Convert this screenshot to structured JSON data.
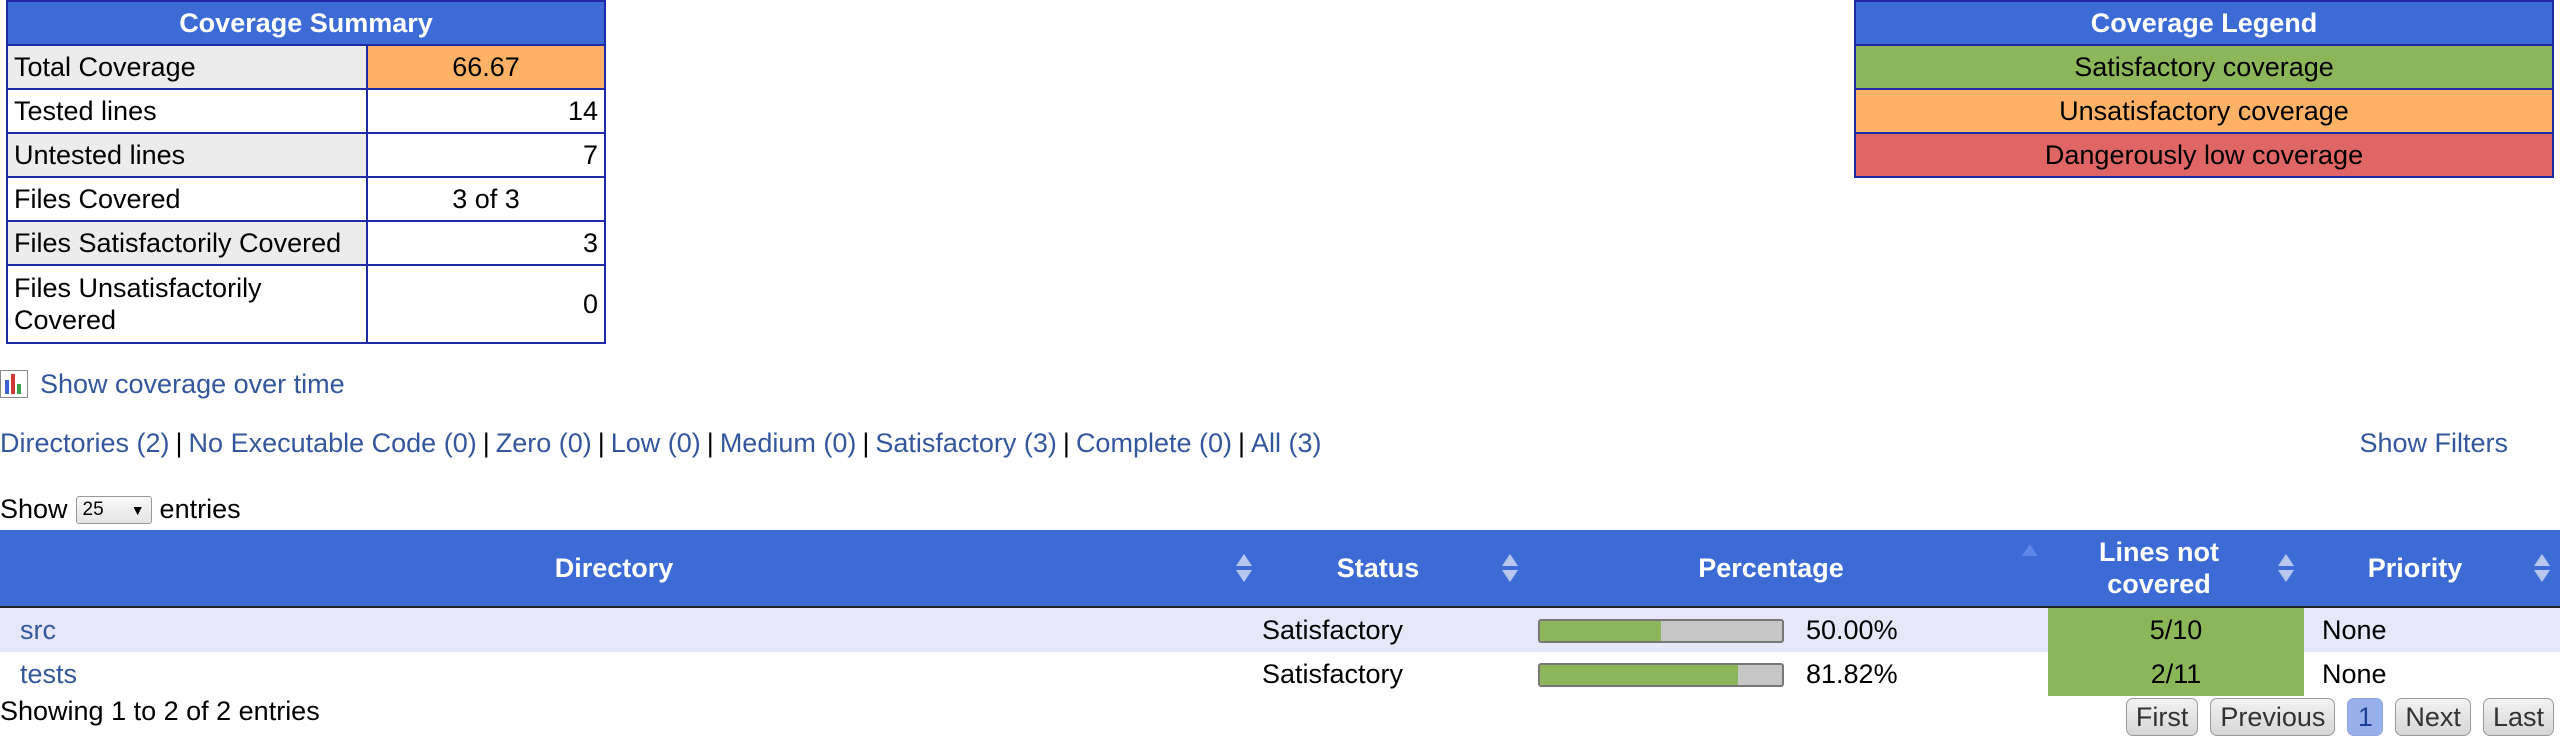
{
  "summary": {
    "title": "Coverage Summary",
    "rows": [
      {
        "label": "Total Coverage",
        "value": "66.67"
      },
      {
        "label": "Tested lines",
        "value": "14"
      },
      {
        "label": "Untested lines",
        "value": "7"
      },
      {
        "label": "Files Covered",
        "value": "3 of 3"
      },
      {
        "label": "Files Satisfactorily Covered",
        "value": "3"
      },
      {
        "label": "Files Unsatisfactorily Covered",
        "value": "0"
      }
    ]
  },
  "legend": {
    "title": "Coverage Legend",
    "items": [
      {
        "label": "Satisfactory coverage",
        "color": "#8cb65a"
      },
      {
        "label": "Unsatisfactory coverage",
        "color": "#ffb266"
      },
      {
        "label": "Dangerously low coverage",
        "color": "#e06666"
      }
    ]
  },
  "coverage_over_time": {
    "label": "Show coverage over time",
    "icon": "bar-chart-icon"
  },
  "filters": {
    "links": [
      "Directories (2)",
      "No Executable Code (0)",
      "Zero (0)",
      "Low (0)",
      "Medium (0)",
      "Satisfactory (3)",
      "Complete (0)",
      "All (3)"
    ],
    "show_filters": "Show Filters"
  },
  "entries": {
    "prefix": "Show",
    "selected": "25",
    "suffix": "entries"
  },
  "table": {
    "columns": [
      "Directory",
      "Status",
      "Percentage",
      "Lines not covered",
      "Priority"
    ],
    "rows": [
      {
        "directory": "src",
        "status": "Satisfactory",
        "percentage": "50.00%",
        "fill": 0.5,
        "lines_not_covered": "5/10",
        "priority": "None"
      },
      {
        "directory": "tests",
        "status": "Satisfactory",
        "percentage": "81.82%",
        "fill": 0.8182,
        "lines_not_covered": "2/11",
        "priority": "None"
      }
    ]
  },
  "footer": {
    "info": "Showing 1 to 2 of 2 entries",
    "pager": {
      "first": "First",
      "previous": "Previous",
      "current": "1",
      "next": "Next",
      "last": "Last"
    }
  },
  "colors": {
    "header_blue": "#3d6bd6",
    "link": "#33579c",
    "satisfactory": "#8cb65a",
    "unsatisfactory": "#ffb266"
  }
}
